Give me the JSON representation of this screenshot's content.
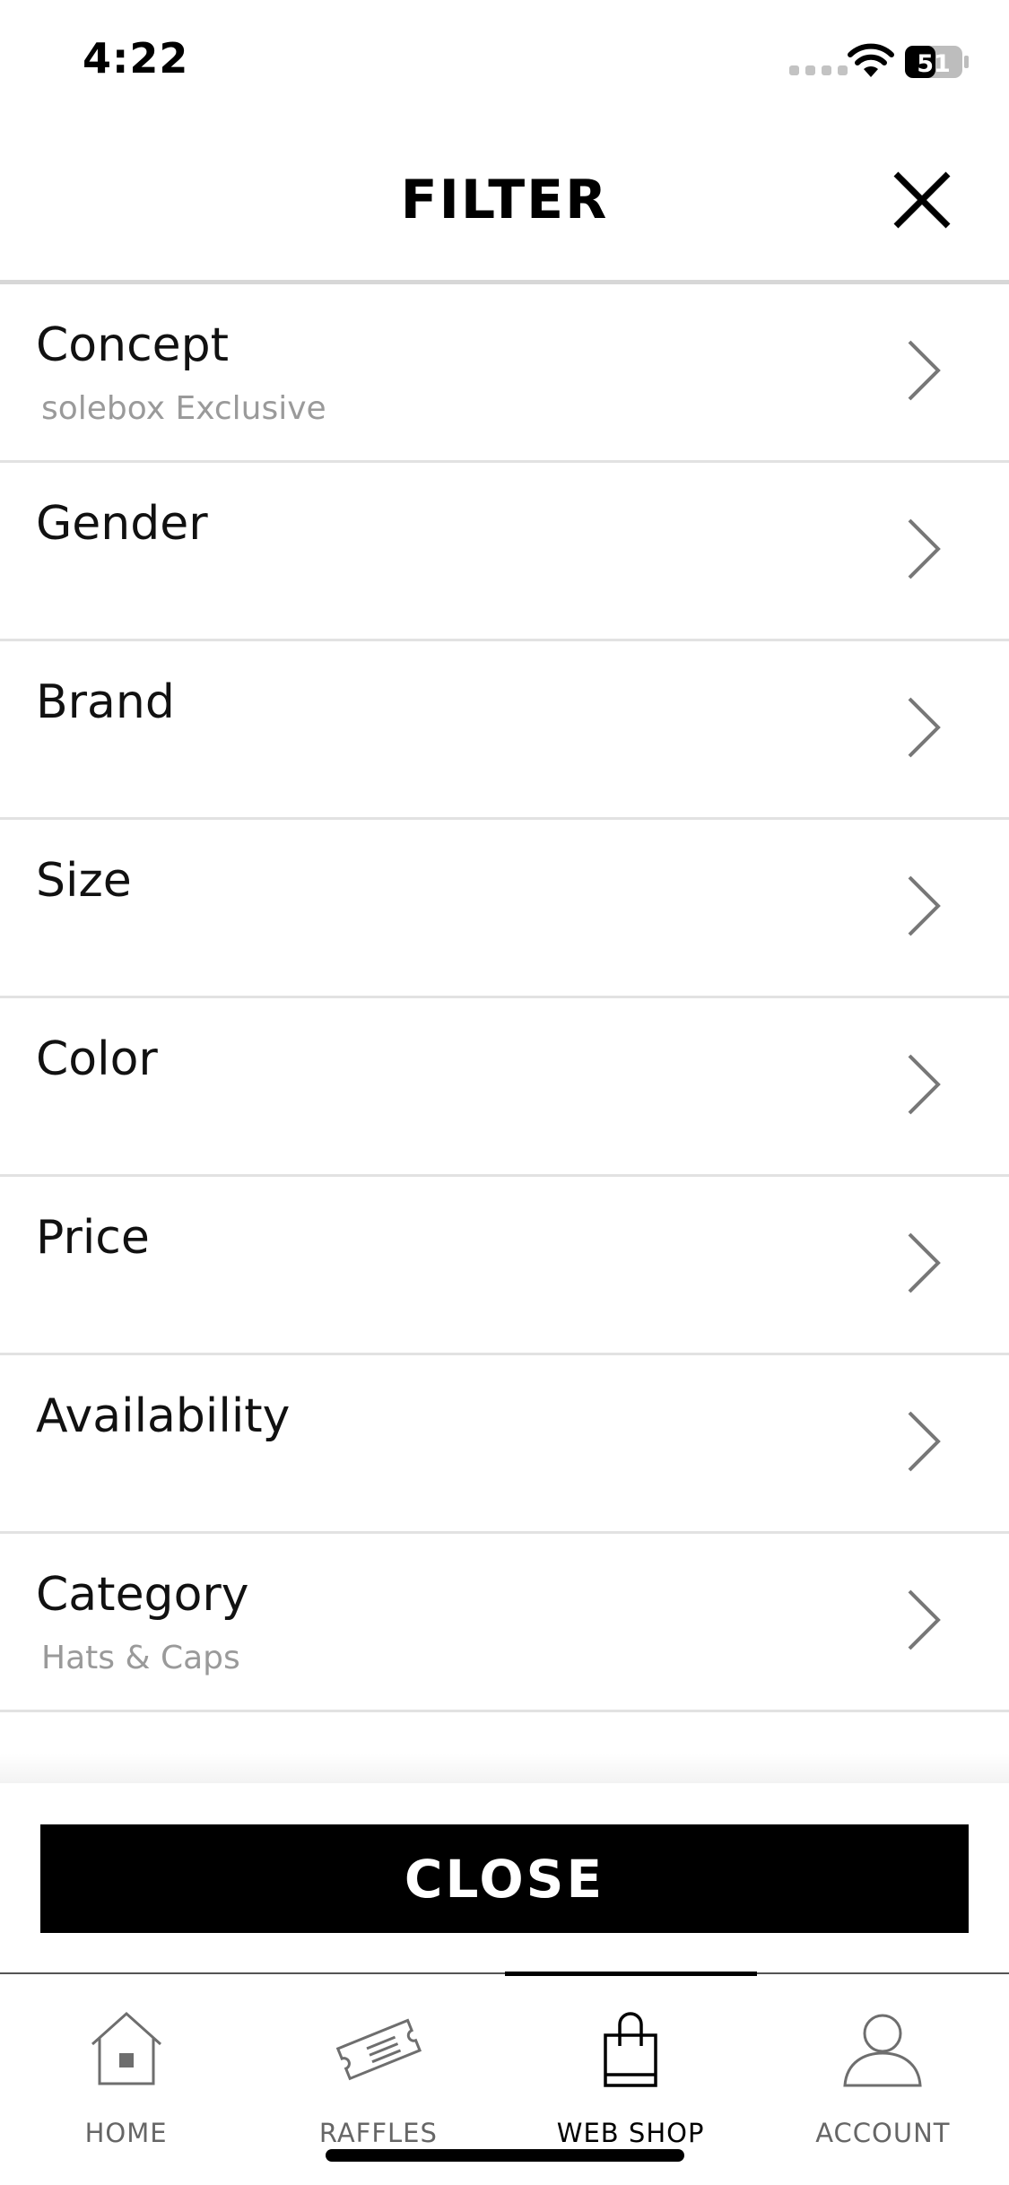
{
  "status_bar": {
    "time": "4:22",
    "battery": "51"
  },
  "header": {
    "title": "FILTER"
  },
  "filters": [
    {
      "label": "Concept",
      "value": "solebox Exclusive"
    },
    {
      "label": "Gender",
      "value": ""
    },
    {
      "label": "Brand",
      "value": ""
    },
    {
      "label": "Size",
      "value": ""
    },
    {
      "label": "Color",
      "value": ""
    },
    {
      "label": "Price",
      "value": ""
    },
    {
      "label": "Availability",
      "value": ""
    },
    {
      "label": "Category",
      "value": "Hats & Caps"
    }
  ],
  "footer": {
    "close_label": "CLOSE"
  },
  "tabs": [
    {
      "label": "HOME",
      "icon": "home-icon",
      "active": false
    },
    {
      "label": "RAFFLES",
      "icon": "ticket-icon",
      "active": false
    },
    {
      "label": "WEB SHOP",
      "icon": "shopping-bag-icon",
      "active": true
    },
    {
      "label": "ACCOUNT",
      "icon": "user-icon",
      "active": false
    }
  ],
  "colors": {
    "accent": "#000000",
    "divider": "#e2e2e2",
    "subtext": "#9a9a9a"
  }
}
